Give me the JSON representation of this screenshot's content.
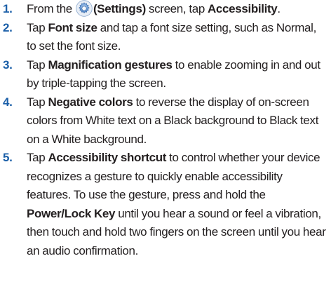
{
  "steps": [
    {
      "number": "1.",
      "pre": "From the ",
      "icon": "settings-icon",
      "icon_label": "(Settings)",
      "mid": " screen, tap ",
      "bold": "Accessibility",
      "post": "."
    },
    {
      "number": "2.",
      "pre": "Tap ",
      "bold": "Font size",
      "post": " and tap a font size setting, such as Normal, to set the font size."
    },
    {
      "number": "3.",
      "pre": "Tap ",
      "bold": "Magnification gestures",
      "post": " to enable zooming in and out by triple-tapping the screen."
    },
    {
      "number": "4.",
      "pre": "Tap ",
      "bold": "Negative colors",
      "post": " to reverse the display of on-screen colors from White text on a Black background to Black text on a White background."
    },
    {
      "number": "5.",
      "pre": "Tap ",
      "bold": "Accessibility shortcut",
      "post": " to control whether your device recognizes a gesture to quickly enable accessibility features. To use the gesture, press and hold the ",
      "bold2": "Power/Lock Key",
      "post2": " until you hear a sound or feel a vibration, then touch and hold two fingers on the screen until you hear an audio confirmation."
    }
  ],
  "colors": {
    "number": "#1b5fa8",
    "text": "#231f20",
    "icon_blue": "#3b78c4"
  }
}
